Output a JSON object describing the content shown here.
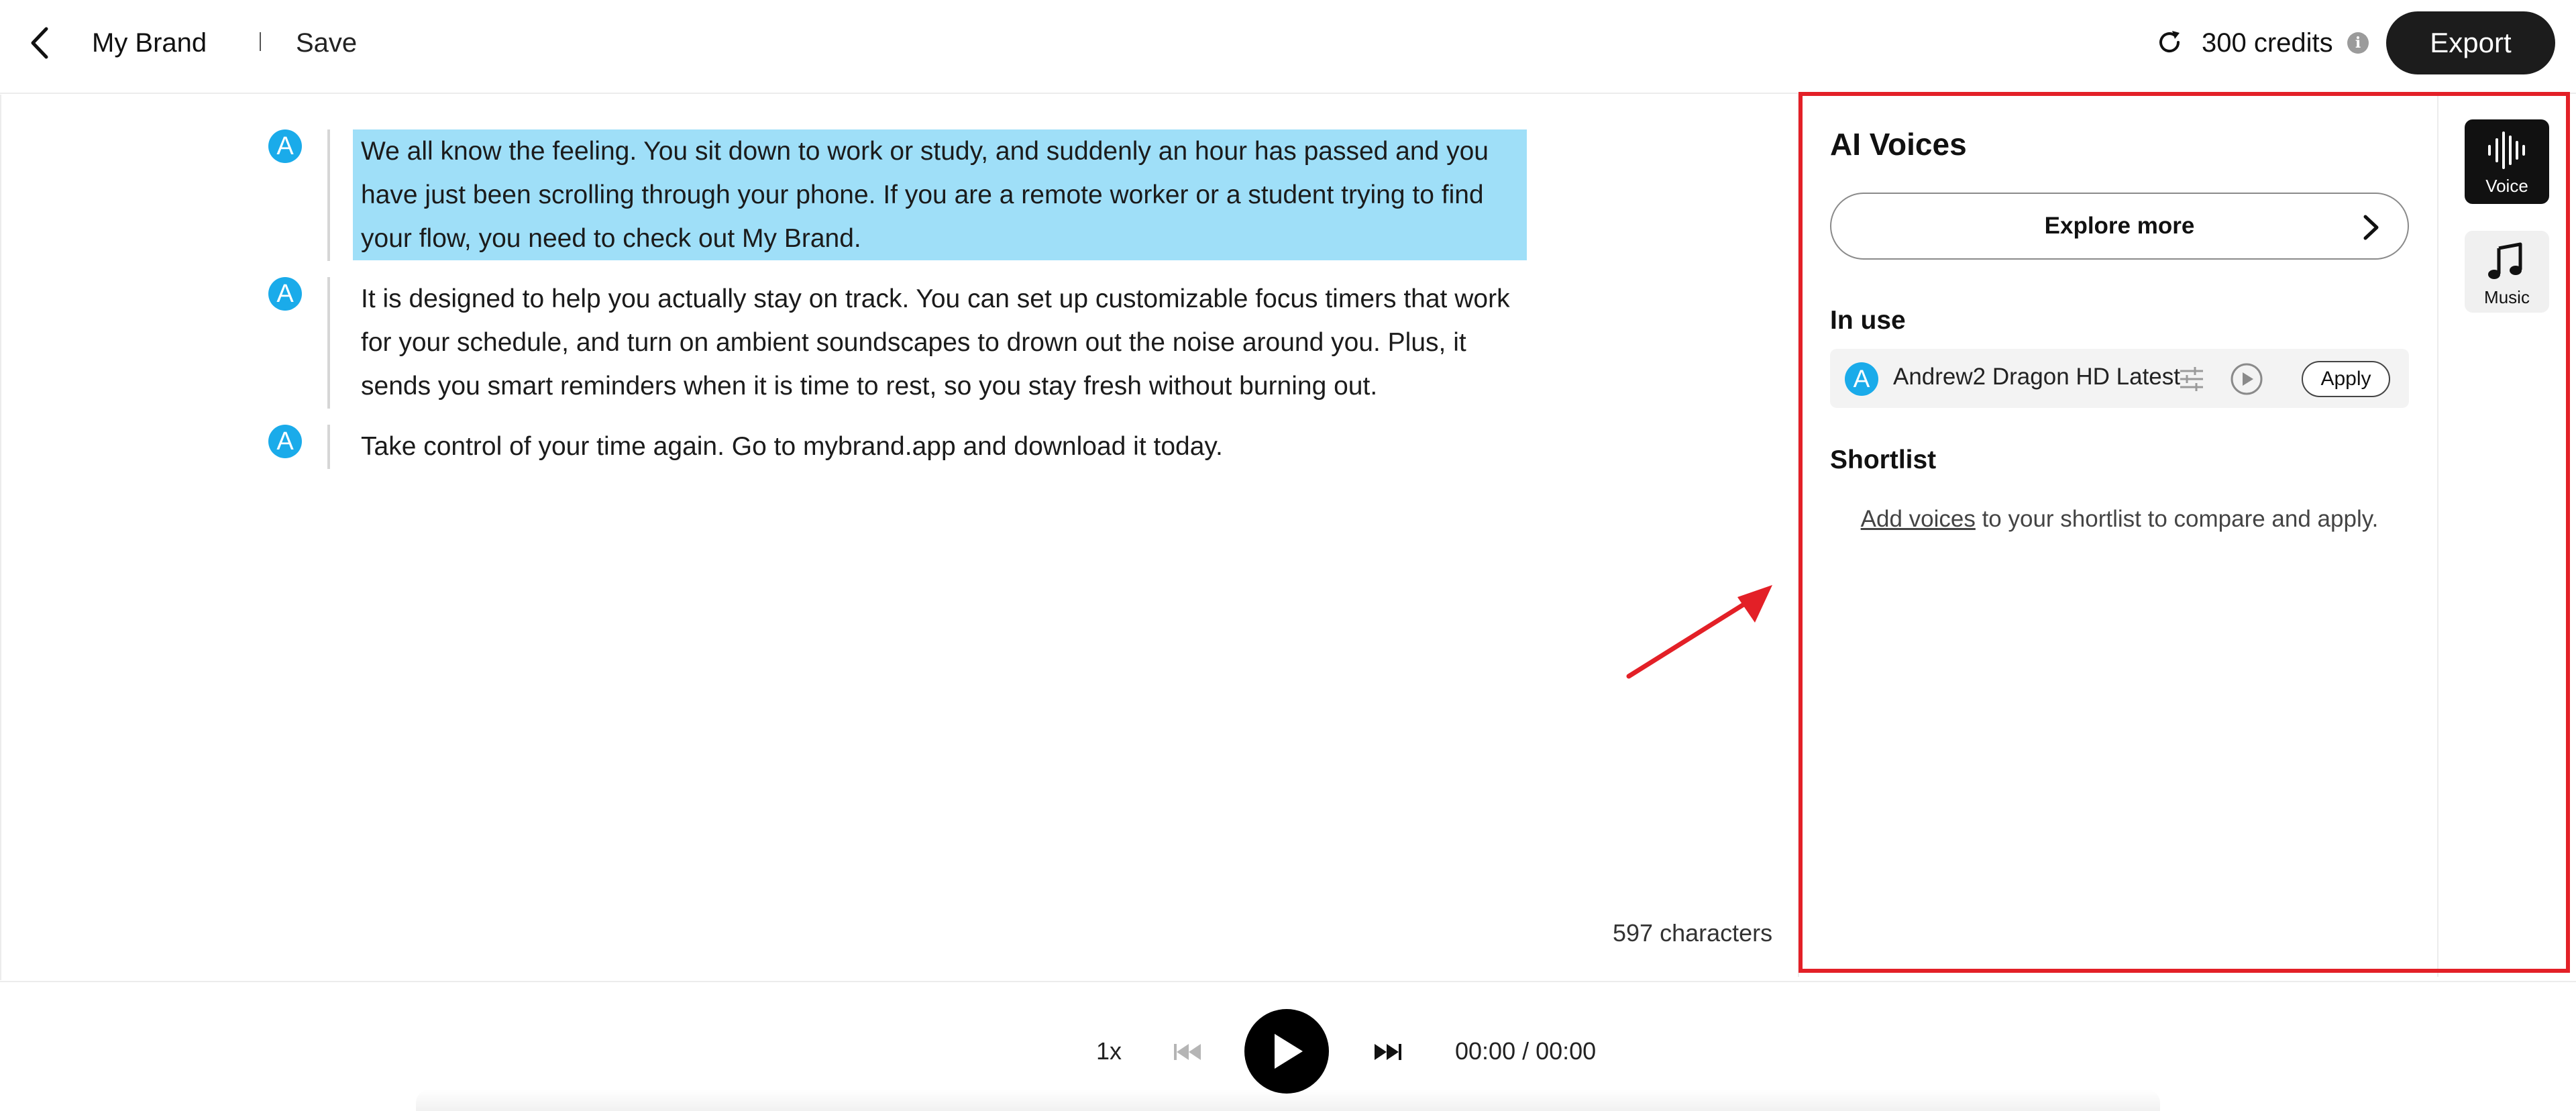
{
  "header": {
    "project_name": "My Brand",
    "save_label": "Save",
    "credits": "300 credits",
    "info_glyph": "i",
    "export_label": "Export"
  },
  "editor": {
    "paragraphs": [
      {
        "speaker_initial": "A",
        "text": "We all know the feeling. You sit down to work or study, and suddenly an hour has passed and you have just been scrolling through your phone. If you are a remote worker or a student trying to find your flow, you need to check out My Brand.",
        "selected": true
      },
      {
        "speaker_initial": "A",
        "text": "It is designed to help you actually stay on track. You can set up customizable focus timers that work for your schedule, and turn on ambient soundscapes to drown out the noise around you. Plus, it sends you smart reminders when it is time to rest, so you stay fresh without burning out.",
        "selected": false
      },
      {
        "speaker_initial": "A",
        "text": "Take control of your time again. Go to mybrand.app and download it today.",
        "selected": false
      }
    ],
    "char_count": "597 characters"
  },
  "voice_panel": {
    "title": "AI Voices",
    "explore_label": "Explore more",
    "in_use_title": "In use",
    "in_use_voice": {
      "initial": "A",
      "name": "Andrew2 Dragon HD Latest",
      "apply_label": "Apply"
    },
    "shortlist_title": "Shortlist",
    "shortlist_link": "Add voices",
    "shortlist_rest": " to your shortlist to compare and apply."
  },
  "rail": {
    "voice_label": "Voice",
    "music_label": "Music",
    "music_glyph": "♫"
  },
  "player": {
    "speed": "1x",
    "time": "00:00 / 00:00"
  },
  "colors": {
    "accent_blue": "#1aabea",
    "selection": "#9fdff8",
    "annotation_red": "#e32027",
    "dark": "#1c1c1c"
  },
  "icons": {
    "back": "back-chevron-icon",
    "refresh": "refresh-icon",
    "info": "info-icon",
    "chevron": "chevron-right-icon",
    "settings": "sliders-icon",
    "play": "play-icon",
    "voice": "waveform-icon",
    "music": "music-note-icon",
    "prev": "skip-back-icon",
    "next": "skip-forward-icon"
  }
}
